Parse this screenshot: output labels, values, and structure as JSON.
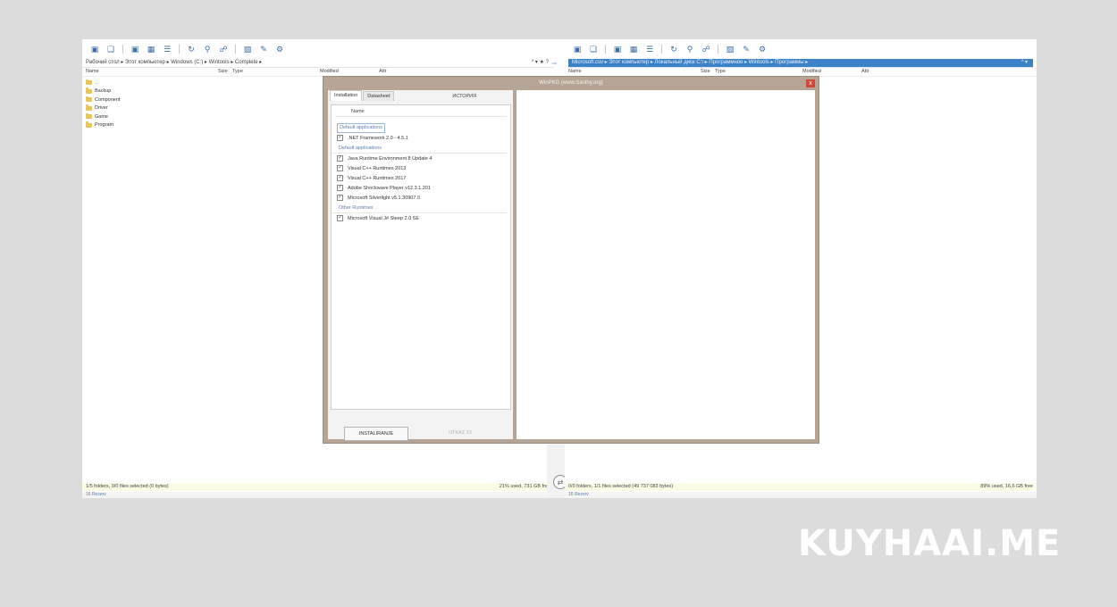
{
  "left_pane": {
    "path": "Рабочий стол ▸ Этот компьютер ▸ Windows (C:) ▸ Wintools ▸ Complete ▸",
    "path_controls": "* ▾ ★ ?",
    "columns": [
      "Name",
      "Size",
      "Type",
      "Modified",
      "Attr"
    ],
    "files": [
      "..",
      "Backup",
      "Component",
      "Driver",
      "Game",
      "Program"
    ],
    "status": "1/5 folders, 0/0 files selected (0 bytes)",
    "free": "21% used, 731 GB free",
    "bottom": "16 Rezerv"
  },
  "right_pane": {
    "path": "Microsoft.csv ▸ Этот компьютер ▸ Локальный диск C:\\ ▸ Программное ▸ Wintools ▸ Программы ▸",
    "path_controls": "* ▾",
    "columns": [
      "Name",
      "Size",
      "Type",
      "Modified",
      "Attr"
    ],
    "status": "0/0 folders, 1/1 files selected (49 737 083 bytes)",
    "free": "89% used, 16,6 GB free",
    "bottom": "16 Rezerv"
  },
  "dialog": {
    "title": "WinPKG (www.Santhy.org)",
    "close": "x",
    "tabs": [
      "Installation",
      "Datasheet"
    ],
    "tab_extra": "ИСТОРИЯ",
    "header": "Name",
    "groups": [
      {
        "label": "Default applications",
        "boxed": true,
        "items": [
          ".NET Framework 2.0 - 4.5.1"
        ]
      },
      {
        "label": "Default applications",
        "boxed": false,
        "items": [
          "Java Runtime Environment 8 Update 4",
          "Visual C++ Runtimes 2013",
          "Visual C++ Runtimes 2017",
          "Adobe Shockwave Player v12.3.1.201",
          "Microsoft Silverlight v5.1.30907.0"
        ]
      },
      {
        "label": "Other Runtimes",
        "boxed": false,
        "items": [
          "Microsoft Visual J# Steep 2.0 SE"
        ]
      }
    ],
    "install_label": "INSTALIRANJE",
    "cancel_label": "OTKAZ 1X"
  },
  "toolbar_icons": [
    "drive-icon",
    "copy-icon",
    "drive-icon",
    "view-icon",
    "list-icon",
    "sync-icon",
    "find-icon",
    "ftp-icon",
    "archive-icon",
    "edit-icon",
    "settings-icon"
  ],
  "center": {
    "swap_glyph": "⇄",
    "side_glyph": "⇨"
  },
  "watermark": "KUYHAAI.ME",
  "colors": {
    "selection": "#3c82c8",
    "dialog_frame": "#b6a496",
    "close": "#d0483a",
    "status": "#fbfbe6"
  }
}
